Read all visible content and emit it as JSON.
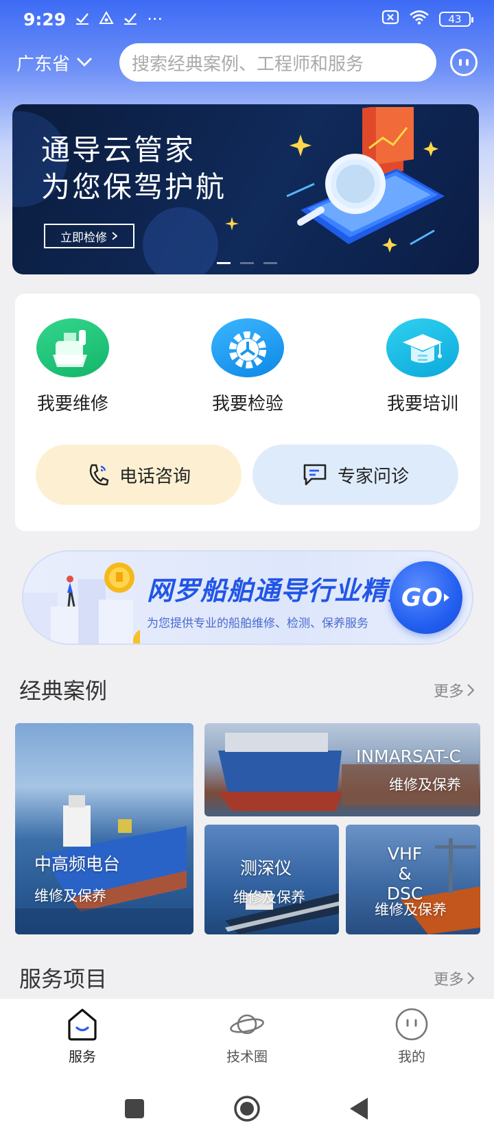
{
  "status_bar": {
    "time": "9:29",
    "battery": "43",
    "extra_dots": "···"
  },
  "header": {
    "province": "广东省",
    "search_placeholder": "搜索经典案例、工程师和服务"
  },
  "banner": {
    "line1": "通导云管家",
    "line2": "为您保驾护航",
    "button_label": "立即检修",
    "page_count": 3,
    "active_page": 1
  },
  "quick_actions": [
    {
      "label": "我要维修",
      "icon": "ship-icon",
      "color": "#1ec07a"
    },
    {
      "label": "我要检验",
      "icon": "gear-icon",
      "color": "#1a9ff0"
    },
    {
      "label": "我要培训",
      "icon": "graduation-cap-icon",
      "color": "#12b8e6"
    }
  ],
  "consult": {
    "phone_label": "电话咨询",
    "expert_label": "专家问诊"
  },
  "promo": {
    "title": "网罗船舶通导行业精英",
    "subtitle": "为您提供专业的船舶维修、检测、保养服务",
    "go_label": "GO"
  },
  "classic_cases": {
    "title": "经典案例",
    "more": "更多",
    "items": [
      {
        "title": "中高频电台",
        "subtitle": "维修及保养"
      },
      {
        "title": "INMARSAT-C",
        "subtitle": "维修及保养"
      },
      {
        "title": "测深仪",
        "subtitle": "维修及保养"
      },
      {
        "title": "VHF &",
        "title2": "DSC",
        "subtitle": "维修及保养"
      }
    ]
  },
  "service_items": {
    "title": "服务项目",
    "more": "更多"
  },
  "bottom_nav": [
    {
      "label": "服务",
      "icon": "home-icon",
      "active": true
    },
    {
      "label": "技术圈",
      "icon": "planet-icon",
      "active": false
    },
    {
      "label": "我的",
      "icon": "face-icon",
      "active": false
    }
  ],
  "colors": {
    "primary": "#2a5cf0",
    "phone_pill": "#fdf0d2",
    "expert_pill": "#deebfb"
  }
}
